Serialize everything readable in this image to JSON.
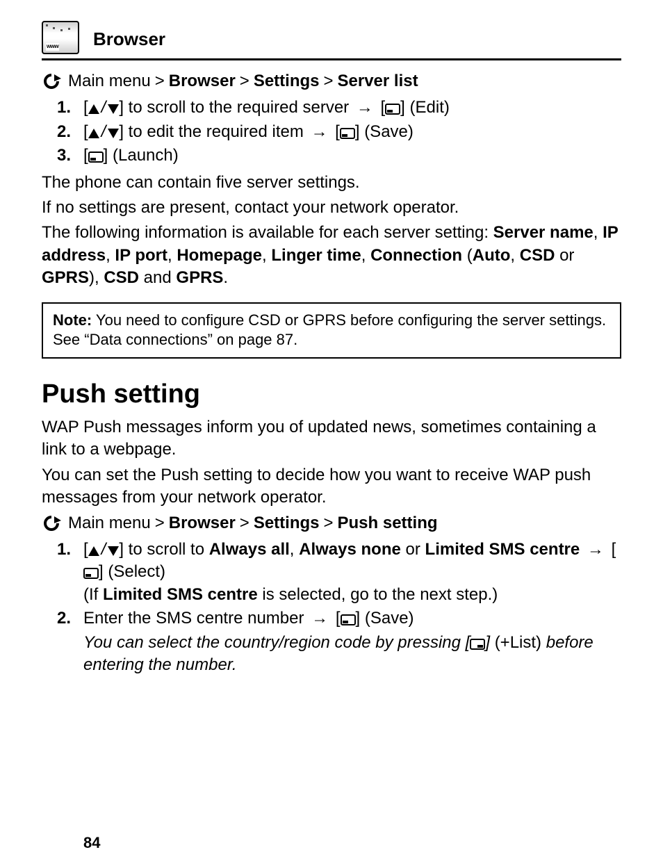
{
  "header": {
    "title": "Browser",
    "icon_label": "www",
    "icon_name": "browser-www-icon"
  },
  "breadcrumb1": {
    "lead": "Main menu",
    "sep": ">",
    "items": [
      "Browser",
      "Settings",
      "Server list"
    ]
  },
  "steps1": [
    {
      "num": "1.",
      "pre": "[",
      "mid": "] to scroll to the required server",
      "action": "(Edit)"
    },
    {
      "num": "2.",
      "pre": "[",
      "mid": "] to edit the required item",
      "action": "(Save)"
    },
    {
      "num": "3.",
      "pre": "[",
      "action": "(Launch)"
    }
  ],
  "paras1": [
    "The phone can contain five server settings.",
    "If no settings are present, contact your network operator."
  ],
  "server_info": {
    "lead": "The following information is available for each server setting: ",
    "bold_items": [
      "Server name",
      "IP address",
      "IP port",
      "Homepage",
      "Linger time",
      "Connection"
    ],
    "paren_lead": "(",
    "paren_items": [
      "Auto",
      "CSD",
      "GPRS"
    ],
    "paren_or": " or ",
    "paren_close": "), ",
    "tail_items": [
      "CSD",
      "GPRS"
    ],
    "tail_and": " and ",
    "tail_end": "."
  },
  "note": {
    "label": "Note:",
    "text": " You need to configure CSD or GPRS before configuring the server settings. See “Data connections” on page 87."
  },
  "section_title": "Push setting",
  "paras2": [
    "WAP Push messages inform you of updated news, sometimes containing a link to a webpage.",
    "You can set the Push setting to decide how you want to receive WAP push messages from your network operator."
  ],
  "breadcrumb2": {
    "lead": "Main menu",
    "sep": ">",
    "items": [
      "Browser",
      "Settings",
      "Push setting"
    ]
  },
  "steps2": {
    "s1": {
      "num": "1.",
      "pre": "[",
      "mid1": "] to scroll to ",
      "opts": [
        "Always all",
        "Always none",
        "Limited SMS centre"
      ],
      "sep_comma": ", ",
      "sep_or": " or ",
      "sel_open": " [",
      "sel_close": "] ",
      "action": "(Select)",
      "sub_lead": "(If ",
      "sub_bold": "Limited SMS centre",
      "sub_tail": " is selected, go to the next step.)"
    },
    "s2": {
      "num": "2.",
      "text": "Enter the SMS centre number",
      "sel_open": " [",
      "sel_close": "] ",
      "action": "(Save)",
      "note_pre": "You can select the country/region code by pressing",
      "note_btn_open": " [",
      "note_btn_close": "] ",
      "note_btn_label": "(+List)",
      "note_post": " before entering the number."
    }
  },
  "glyphs": {
    "slash": "/",
    "arrow": "→",
    "bracket_close": "]",
    "bracket_open": "["
  },
  "page_number": "84"
}
